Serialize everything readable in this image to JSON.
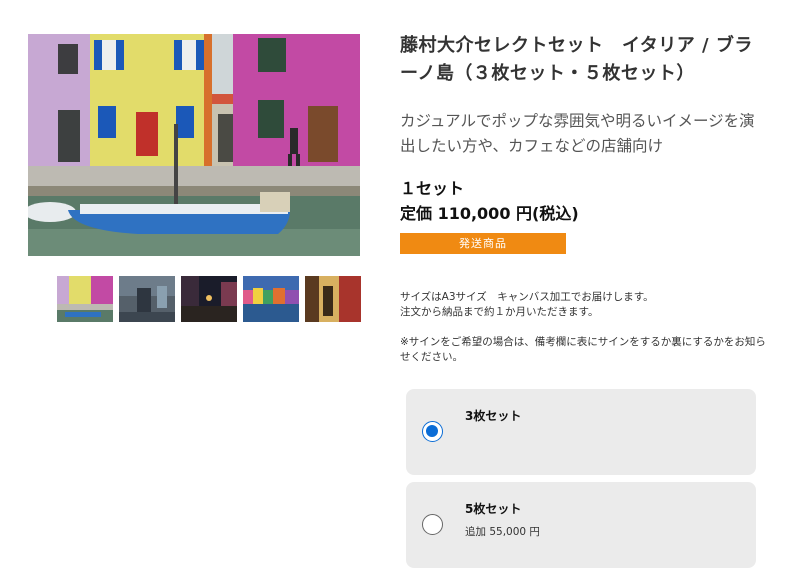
{
  "product": {
    "title": "藤村大介セレクトセット　イタリア / ブラーノ島（３枚セット・５枚セット）",
    "subtitle": "カジュアルでポップな雰囲気や明るいイメージを演出したい方や、カフェなどの店舗向け",
    "set_label": "１セット",
    "price": "定価 110,000 円(税込)",
    "shipping_badge": "発送商品"
  },
  "info": {
    "size_text": "サイズはA3サイズ　キャンバス加工でお届けします。\n注文から納品まで約１か月いただきます。",
    "sign_note": "※サインをご希望の場合は、備考欄に表にサインをするか裏にするかをお知らせください。"
  },
  "options": [
    {
      "label": "3枚セット",
      "extra": "",
      "selected": true
    },
    {
      "label": "5枚セット",
      "extra": "追加 55,000 円",
      "selected": false
    }
  ],
  "colors": {
    "accent_orange": "#f08a12",
    "radio_blue": "#0a6cd6",
    "option_bg": "#ebebeb"
  },
  "gallery": {
    "thumbnail_count": 5
  }
}
